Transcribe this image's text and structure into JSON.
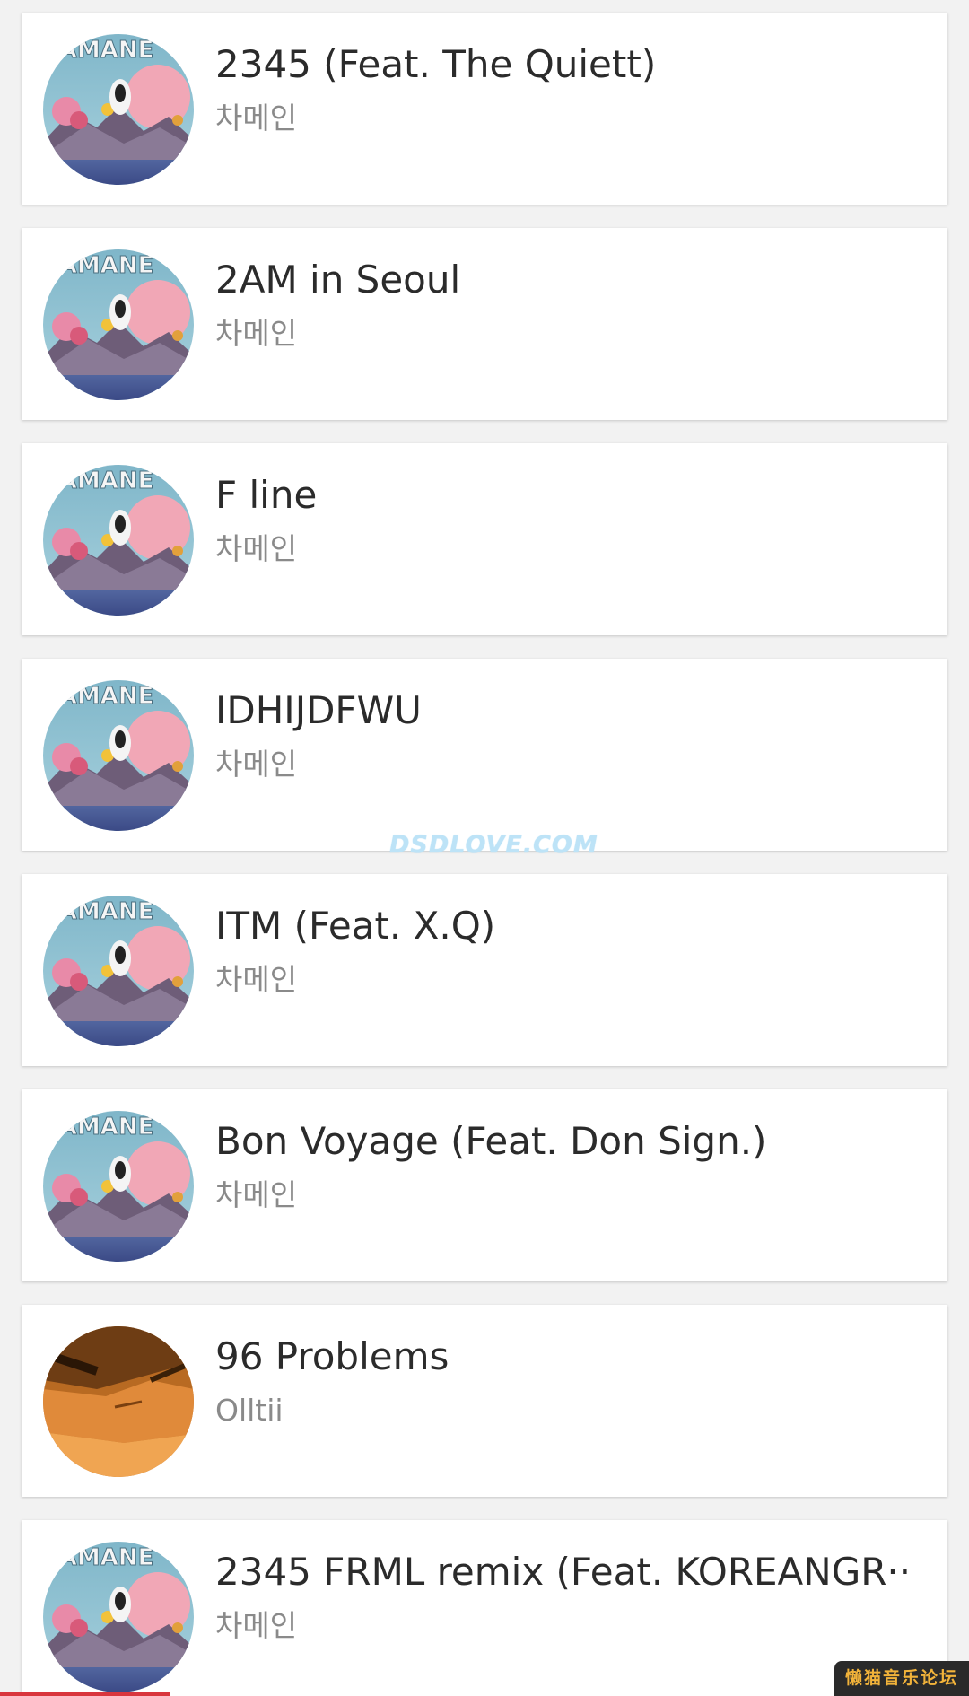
{
  "songs": [
    {
      "title": "2345 (Feat. The Quiett)",
      "artist": "차메인",
      "art": "chamane-cover-art"
    },
    {
      "title": "2AM in Seoul",
      "artist": "차메인",
      "art": "chamane-cover-art"
    },
    {
      "title": "F line",
      "artist": "차메인",
      "art": "chamane-cover-art"
    },
    {
      "title": "IDHIJDFWU",
      "artist": "차메인",
      "art": "chamane-cover-art"
    },
    {
      "title": "ITM (Feat. X.Q)",
      "artist": "차메인",
      "art": "chamane-cover-art"
    },
    {
      "title": "Bon Voyage (Feat. Don Sign.)",
      "artist": "차메인",
      "art": "chamane-cover-art"
    },
    {
      "title": "96 Problems",
      "artist": "Olltii",
      "art": "wood-cover-art"
    },
    {
      "title": "2345 FRML remix (Feat. KOREANGR··",
      "artist": "차메인",
      "art": "chamane-cover-art"
    }
  ],
  "cover_text": "HAMANE",
  "watermark": "DSDLOVE.COM",
  "forum_badge": "懒猫音乐论坛",
  "colors": {
    "background": "#f2f2f2",
    "card": "#ffffff",
    "title_text": "#2b2b2b",
    "artist_text": "#8a8a8a",
    "progress": "#d9363e"
  }
}
